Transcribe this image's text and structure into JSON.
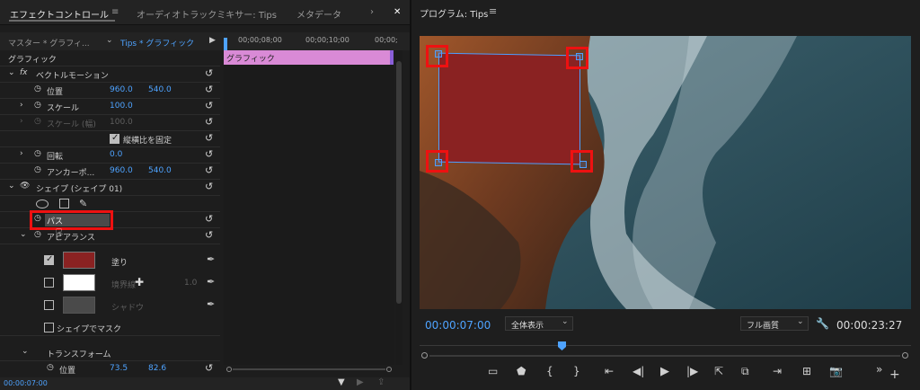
{
  "tabs": {
    "effect_controls": "エフェクトコントロール",
    "menu_glyph": "≡",
    "audio_mixer": "オーディオトラックミキサー: Tips",
    "metadata": "メタデータ",
    "overflow": "›",
    "close": "✕"
  },
  "header": {
    "master": "マスター * グラフィ...",
    "clip": "Tips * グラフィック",
    "play": "▶"
  },
  "timeline": {
    "t1": "00;00;08;00",
    "t2": "00;00;10;00",
    "t3": "00;00;",
    "clip_label": "グラフィック"
  },
  "rows": {
    "graphic": "グラフィック",
    "vector_motion": "ベクトルモーション",
    "position": "位置",
    "pos_x": "960.0",
    "pos_y": "540.0",
    "scale": "スケール",
    "scale_val": "100.0",
    "scale_width": "スケール (幅)",
    "scale_width_val": "100.0",
    "uniform_scale": "縦横比を固定",
    "rotation": "回転",
    "rotation_val": "0.0",
    "anchor": "アンカーポ...",
    "anchor_x": "960.0",
    "anchor_y": "540.0",
    "shape": "シェイプ (シェイプ 01)",
    "path": "パス",
    "appearance": "アピアランス",
    "fill": "塗り",
    "stroke": "境界線",
    "stroke_width": "1.0",
    "shadow": "シャドウ",
    "mask": "シェイプでマスク",
    "transform": "トランスフォーム",
    "t_position": "位置",
    "t_pos_x": "73.5",
    "t_pos_y": "82.6",
    "fx": "fx",
    "reset_glyph": "↺"
  },
  "footer": {
    "timecode": "00:00:07:00"
  },
  "colors": {
    "fill": "#8a2222",
    "stroke": "#ffffff",
    "shadow": "#4a4a4a",
    "accent": "#4ea3ff",
    "highlight": "#e11111"
  },
  "monitor": {
    "title": "プログラム: Tips",
    "menu_glyph": "≡",
    "timecode": "00:00:07:00",
    "fit": "全体表示",
    "quality": "フル画質",
    "duration": "00:00:23:27"
  },
  "icons": [
    "add-marker-icon",
    "marker-icon",
    "mark-in-icon",
    "mark-out-icon",
    "go-to-in-icon",
    "step-back-icon",
    "play-icon",
    "step-forward-icon",
    "go-to-out-icon",
    "lift-icon",
    "extract-icon",
    "overwrite-icon",
    "insert-icon",
    "export-frame-icon"
  ]
}
